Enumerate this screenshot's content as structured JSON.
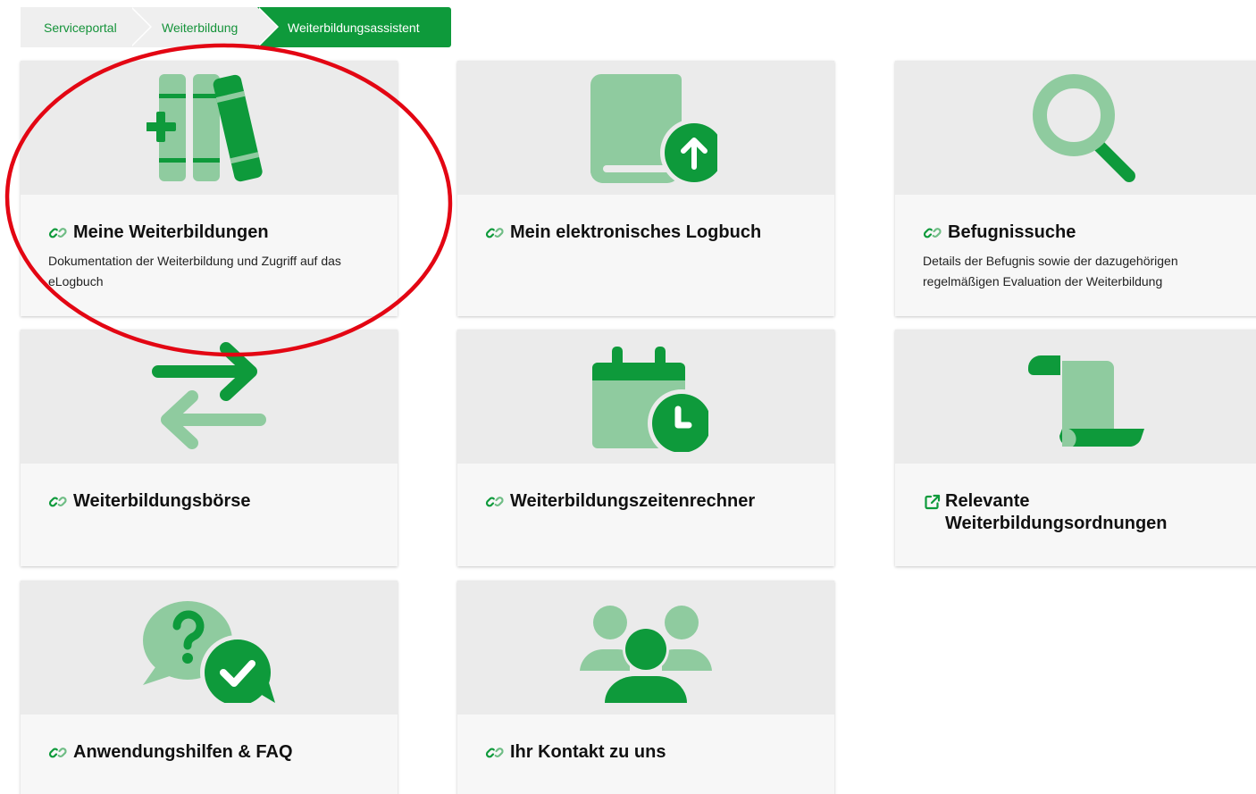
{
  "breadcrumb": {
    "items": [
      "Serviceportal",
      "Weiterbildung",
      "Weiterbildungsassistent"
    ]
  },
  "cards": [
    {
      "title": "Meine Weiterbildungen",
      "description": "Dokumentation der Weiterbildung und Zugriff auf das eLogbuch",
      "icon": "books-medical-icon",
      "link_icon": "link-icon"
    },
    {
      "title": "Mein elektronisches Logbuch",
      "description": "",
      "icon": "logbook-upload-icon",
      "link_icon": "link-icon"
    },
    {
      "title": "Befugnissuche",
      "description": "Details der Befugnis sowie der dazugehörigen regelmäßigen Evaluation der Weiterbildung",
      "icon": "magnifier-icon",
      "link_icon": "link-icon"
    },
    {
      "title": "Weiterbildungsbörse",
      "description": "",
      "icon": "exchange-arrows-icon",
      "link_icon": "link-icon"
    },
    {
      "title": "Weiterbildungszeitenrechner",
      "description": "",
      "icon": "calendar-clock-icon",
      "link_icon": "link-icon"
    },
    {
      "title": "Relevante Weiterbildungsordnungen",
      "description": "",
      "icon": "scroll-icon",
      "link_icon": "external-link-icon"
    },
    {
      "title": "Anwendungshilfen & FAQ",
      "description": "",
      "icon": "question-chat-icon",
      "link_icon": "link-icon"
    },
    {
      "title": "Ihr Kontakt zu uns",
      "description": "",
      "icon": "people-group-icon",
      "link_icon": "link-icon"
    }
  ],
  "colors": {
    "green_dark": "#0e9a3b",
    "green_light": "#8fcb9f",
    "annotation_red": "#e30613"
  }
}
